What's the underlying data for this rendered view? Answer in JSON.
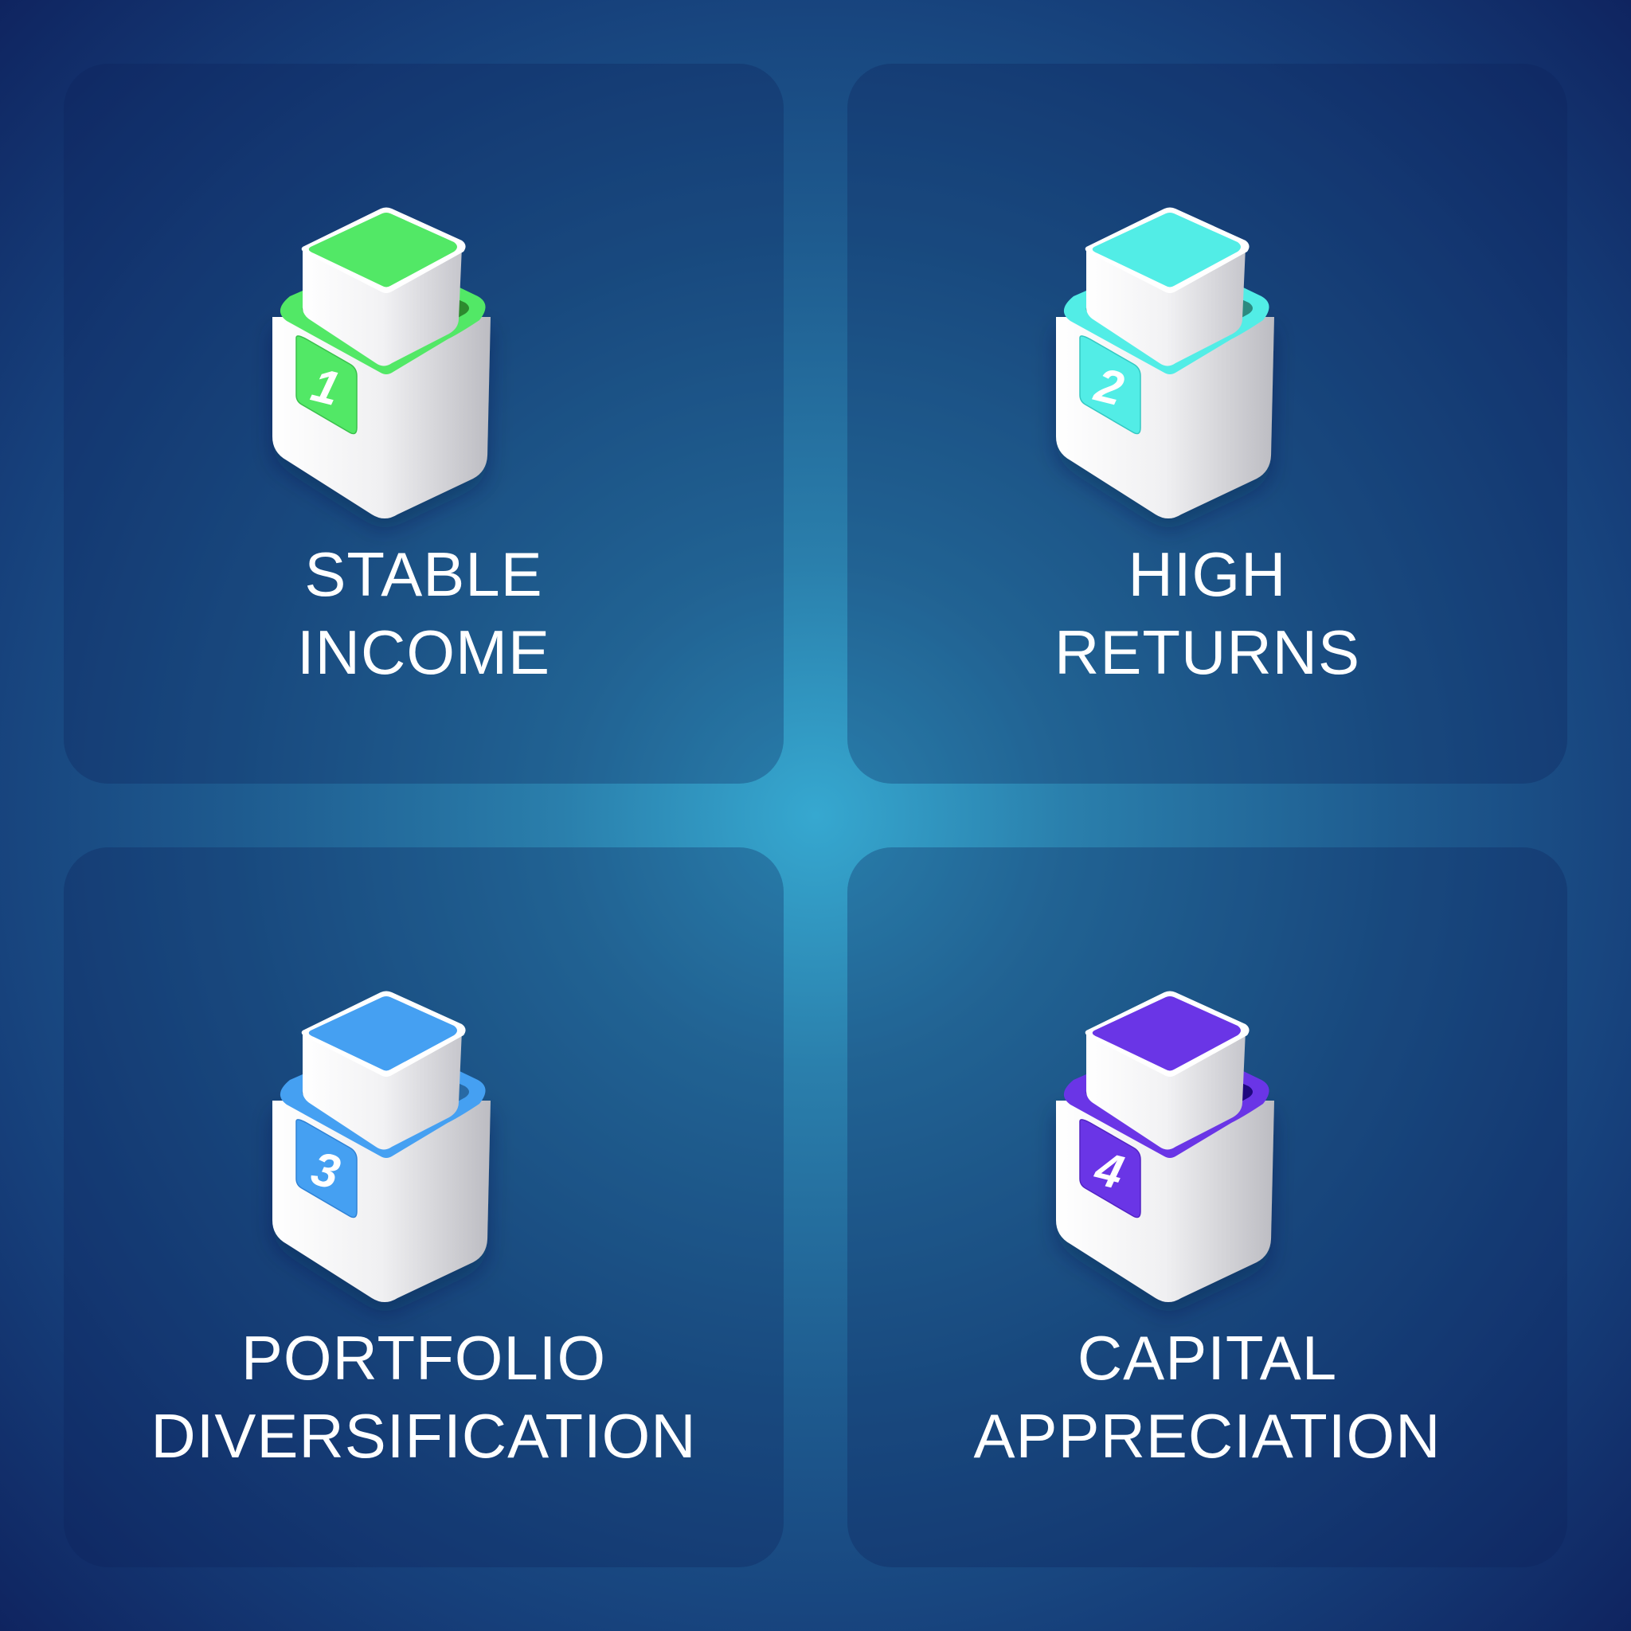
{
  "cards": [
    {
      "number": "1",
      "title_lines": [
        "STABLE",
        "INCOME"
      ],
      "icon": "stacked-box-icon",
      "colors": {
        "accent": "#52e866",
        "well": "#2d8a2e",
        "accent_edge": "#3ac04c"
      }
    },
    {
      "number": "2",
      "title_lines": [
        "HIGH",
        "RETURNS"
      ],
      "icon": "stacked-box-icon",
      "colors": {
        "accent": "#52ede6",
        "well": "#2c8a80",
        "accent_edge": "#34c8c2"
      }
    },
    {
      "number": "3",
      "title_lines": [
        "PORTFOLIO",
        "DIVERSIFICATION"
      ],
      "icon": "stacked-box-icon",
      "colors": {
        "accent": "#45a0f2",
        "well": "#2869a5",
        "accent_edge": "#2f82d6"
      }
    },
    {
      "number": "4",
      "title_lines": [
        "CAPITAL",
        "APPRECIATION"
      ],
      "icon": "stacked-box-icon",
      "colors": {
        "accent": "#6a35e6",
        "well": "#1f087e",
        "accent_edge": "#5223c4"
      }
    }
  ]
}
